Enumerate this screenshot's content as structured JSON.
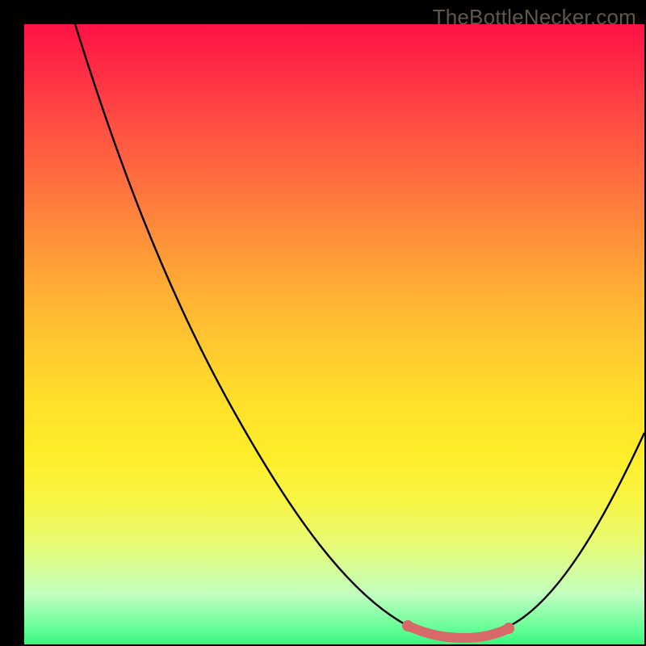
{
  "watermark": "TheBottleNecker.com",
  "chart_data": {
    "type": "line",
    "title": "",
    "xlabel": "",
    "ylabel": "",
    "xlim": [
      0,
      100
    ],
    "ylim": [
      0,
      100
    ],
    "grid": false,
    "curve": {
      "description": "Black V-shaped curve descending steeply from top-left, reaching a minimum near x≈70, then rising toward the right edge.",
      "points": [
        {
          "x": 8,
          "y": 100
        },
        {
          "x": 15,
          "y": 80
        },
        {
          "x": 25,
          "y": 58
        },
        {
          "x": 35,
          "y": 37
        },
        {
          "x": 45,
          "y": 22
        },
        {
          "x": 55,
          "y": 10
        },
        {
          "x": 62,
          "y": 3
        },
        {
          "x": 70,
          "y": 1
        },
        {
          "x": 78,
          "y": 3
        },
        {
          "x": 88,
          "y": 15
        },
        {
          "x": 100,
          "y": 34
        }
      ]
    },
    "highlight_segment": {
      "color": "#d76a69",
      "x_range": [
        62,
        78
      ],
      "description": "Thick pink/rose band marking the flat minimum region of the curve near the bottom."
    },
    "background_gradient": {
      "direction": "top-to-bottom",
      "stops": [
        {
          "pos": 0.0,
          "color": "#ff1246"
        },
        {
          "pos": 0.5,
          "color": "#ffc92f"
        },
        {
          "pos": 0.8,
          "color": "#f7f545"
        },
        {
          "pos": 1.0,
          "color": "#38f47a"
        }
      ]
    },
    "frame_color": "#000000"
  }
}
